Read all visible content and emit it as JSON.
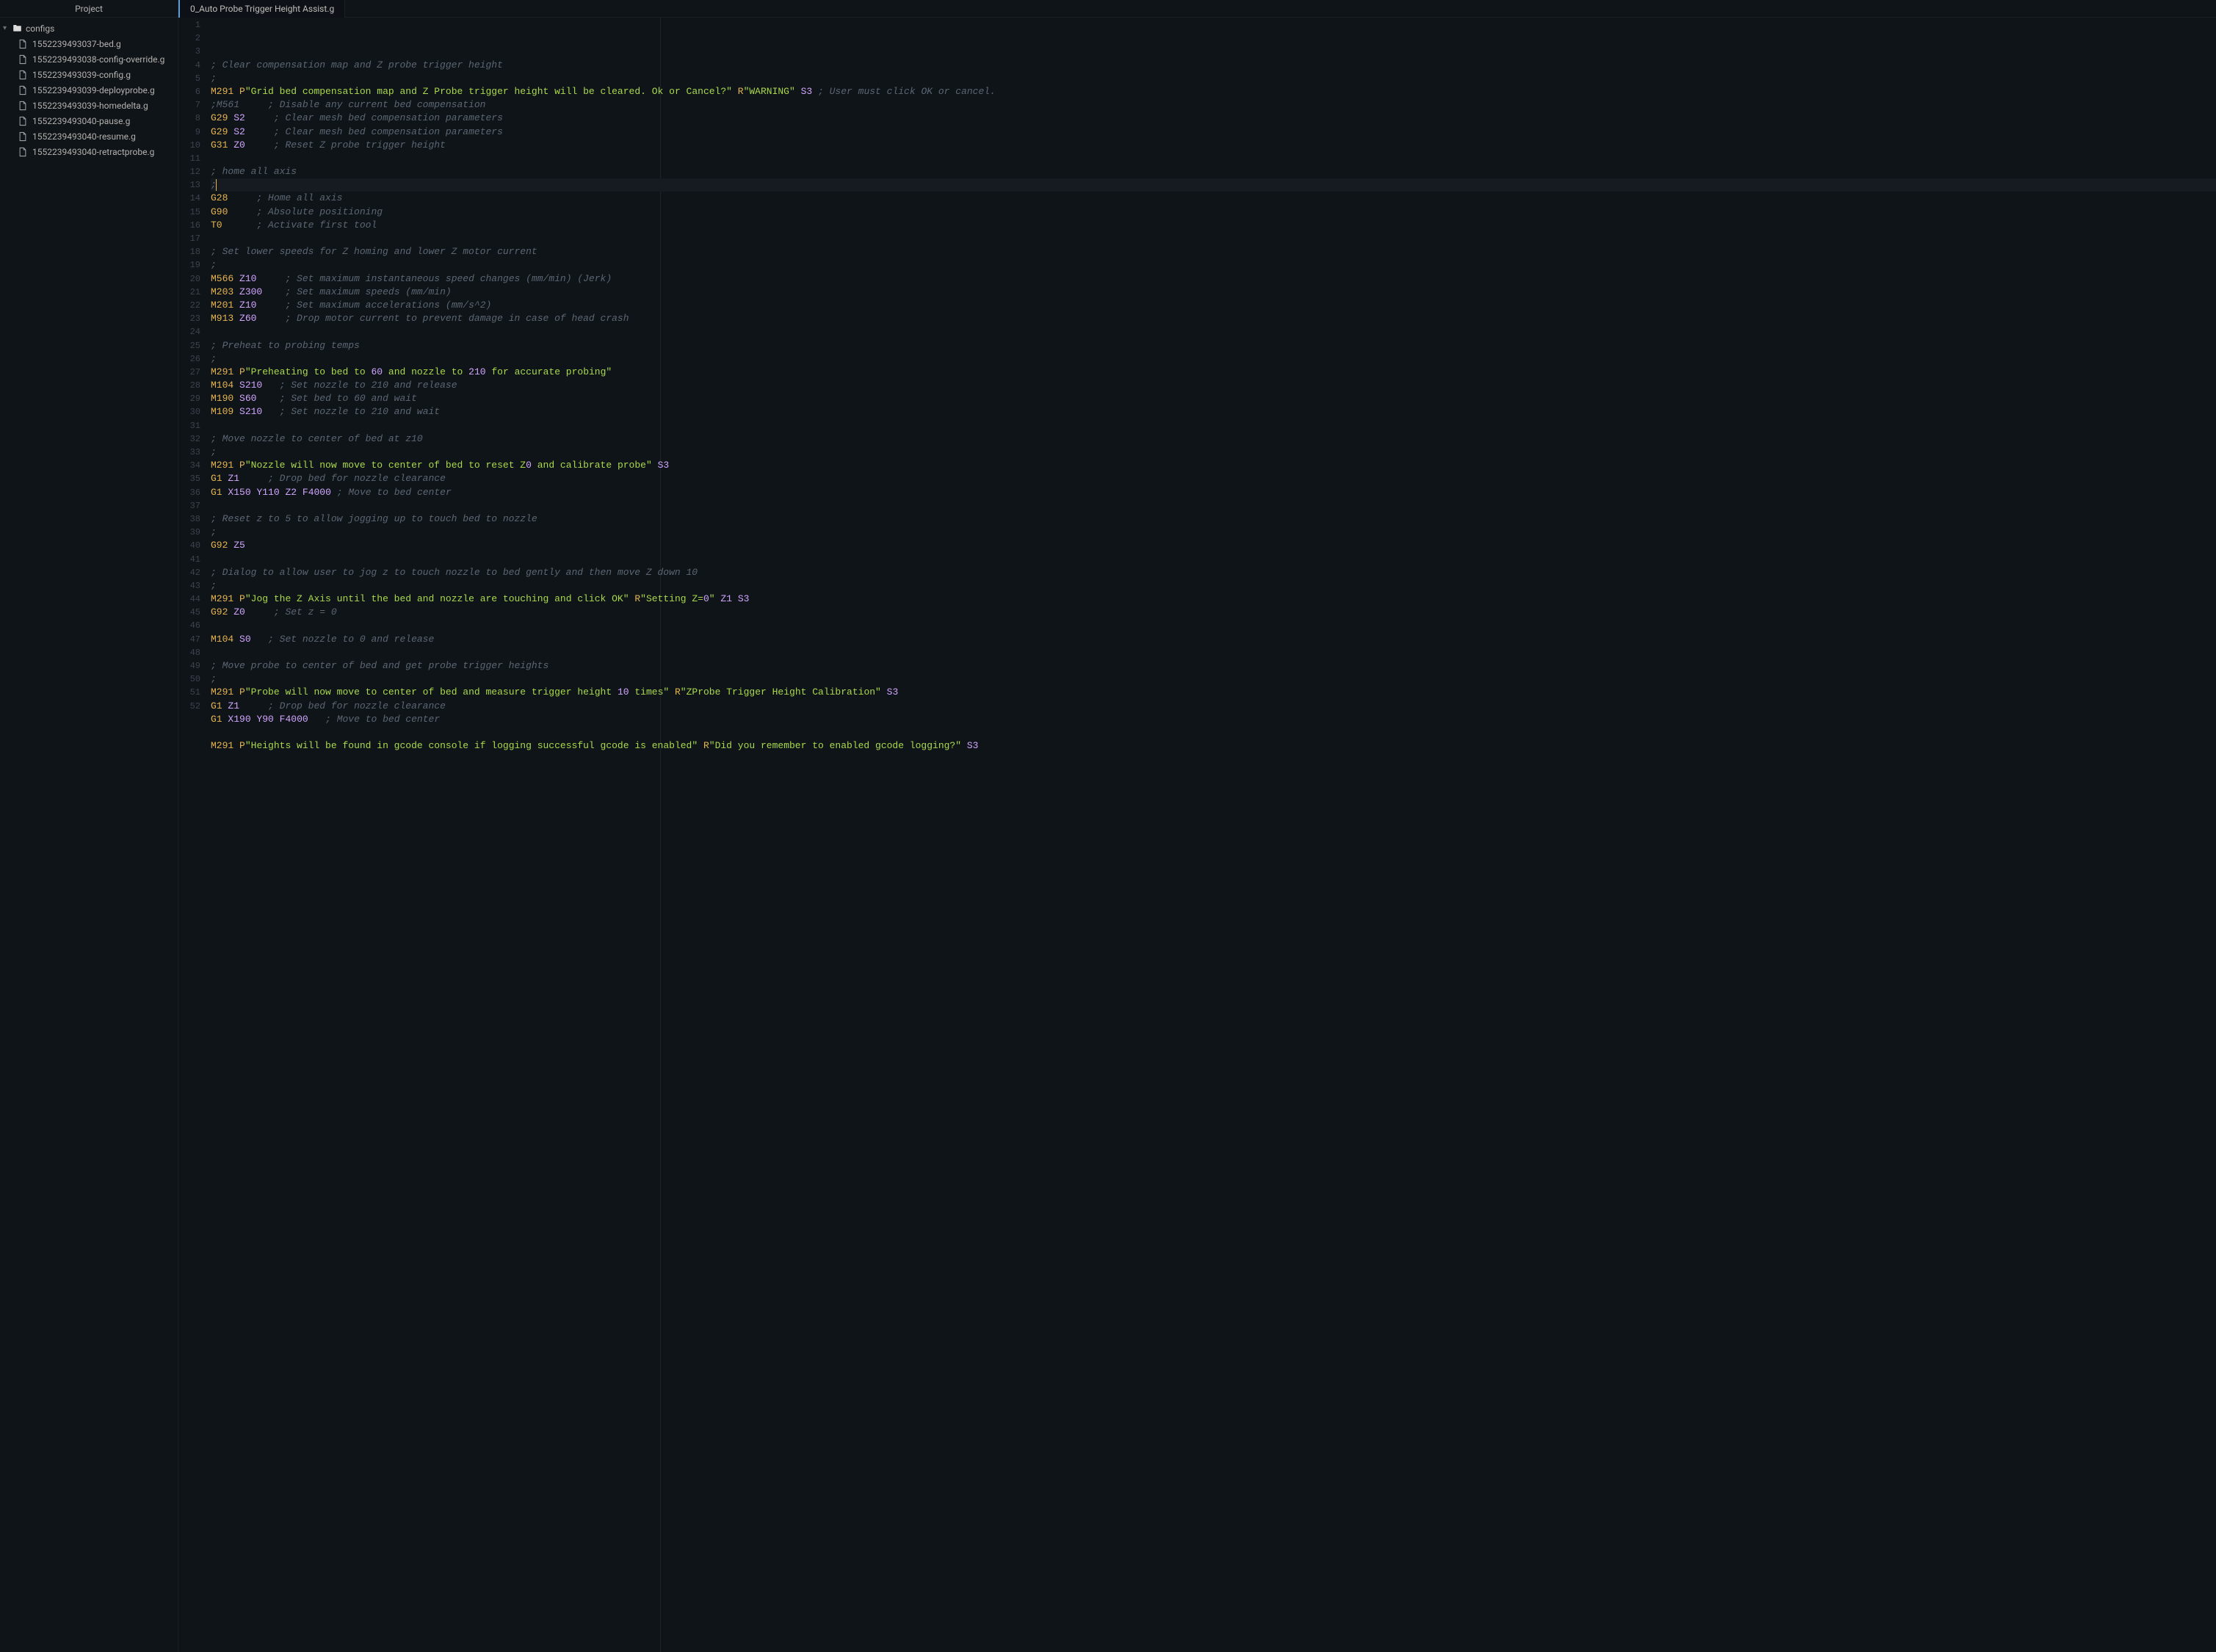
{
  "sidebar": {
    "title": "Project",
    "folder": "configs",
    "files": [
      "1552239493037-bed.g",
      "1552239493038-config-override.g",
      "1552239493039-config.g",
      "1552239493039-deployprobe.g",
      "1552239493039-homedelta.g",
      "1552239493040-pause.g",
      "1552239493040-resume.g",
      "1552239493040-retractprobe.g"
    ]
  },
  "tab": {
    "title": "0_Auto Probe Trigger Height Assist.g"
  },
  "code_lines": [
    {
      "n": 1,
      "tokens": [
        {
          "t": "comment",
          "v": "; Clear compensation map and Z probe trigger height"
        }
      ]
    },
    {
      "n": 2,
      "tokens": [
        {
          "t": "comment",
          "v": ";"
        }
      ]
    },
    {
      "n": 3,
      "tokens": [
        {
          "t": "mcode",
          "v": "M291"
        },
        {
          "t": "plain",
          "v": " "
        },
        {
          "t": "letter",
          "v": "P"
        },
        {
          "t": "str",
          "v": "\"Grid bed compensation map and Z Probe trigger height will be cleared. Ok or Cancel?\""
        },
        {
          "t": "plain",
          "v": " "
        },
        {
          "t": "letter",
          "v": "R"
        },
        {
          "t": "str",
          "v": "\"WARNING\""
        },
        {
          "t": "plain",
          "v": " "
        },
        {
          "t": "param",
          "v": "S3"
        },
        {
          "t": "plain",
          "v": " "
        },
        {
          "t": "comment",
          "v": "; User must click OK or cancel."
        }
      ]
    },
    {
      "n": 4,
      "tokens": [
        {
          "t": "comment",
          "v": ";M561     ; Disable any current bed compensation"
        }
      ]
    },
    {
      "n": 5,
      "tokens": [
        {
          "t": "gcode",
          "v": "G29"
        },
        {
          "t": "plain",
          "v": " "
        },
        {
          "t": "param",
          "v": "S2"
        },
        {
          "t": "plain",
          "v": "     "
        },
        {
          "t": "comment",
          "v": "; Clear mesh bed compensation parameters"
        }
      ]
    },
    {
      "n": 6,
      "tokens": [
        {
          "t": "gcode",
          "v": "G29"
        },
        {
          "t": "plain",
          "v": " "
        },
        {
          "t": "param",
          "v": "S2"
        },
        {
          "t": "plain",
          "v": "     "
        },
        {
          "t": "comment",
          "v": "; Clear mesh bed compensation parameters"
        }
      ]
    },
    {
      "n": 7,
      "tokens": [
        {
          "t": "gcode",
          "v": "G31"
        },
        {
          "t": "plain",
          "v": " "
        },
        {
          "t": "param",
          "v": "Z0"
        },
        {
          "t": "plain",
          "v": "     "
        },
        {
          "t": "comment",
          "v": "; Reset Z probe trigger height"
        }
      ]
    },
    {
      "n": 8,
      "tokens": []
    },
    {
      "n": 9,
      "tokens": [
        {
          "t": "comment",
          "v": "; home all axis"
        }
      ]
    },
    {
      "n": 10,
      "current": true,
      "cursor_after": true,
      "tokens": [
        {
          "t": "comment",
          "v": ";"
        }
      ]
    },
    {
      "n": 11,
      "tokens": [
        {
          "t": "gcode",
          "v": "G28"
        },
        {
          "t": "plain",
          "v": "     "
        },
        {
          "t": "comment",
          "v": "; Home all axis"
        }
      ]
    },
    {
      "n": 12,
      "tokens": [
        {
          "t": "gcode",
          "v": "G90"
        },
        {
          "t": "plain",
          "v": "     "
        },
        {
          "t": "comment",
          "v": "; Absolute positioning"
        }
      ]
    },
    {
      "n": 13,
      "tokens": [
        {
          "t": "gcode",
          "v": "T0"
        },
        {
          "t": "plain",
          "v": "      "
        },
        {
          "t": "comment",
          "v": "; Activate first tool"
        }
      ]
    },
    {
      "n": 14,
      "tokens": []
    },
    {
      "n": 15,
      "tokens": [
        {
          "t": "comment",
          "v": "; Set lower speeds for Z homing and lower Z motor current"
        }
      ]
    },
    {
      "n": 16,
      "tokens": [
        {
          "t": "comment",
          "v": ";"
        }
      ]
    },
    {
      "n": 17,
      "tokens": [
        {
          "t": "mcode",
          "v": "M566"
        },
        {
          "t": "plain",
          "v": " "
        },
        {
          "t": "param",
          "v": "Z10"
        },
        {
          "t": "plain",
          "v": "     "
        },
        {
          "t": "comment",
          "v": "; Set maximum instantaneous speed changes (mm/min) (Jerk)"
        }
      ]
    },
    {
      "n": 18,
      "tokens": [
        {
          "t": "mcode",
          "v": "M203"
        },
        {
          "t": "plain",
          "v": " "
        },
        {
          "t": "param",
          "v": "Z300"
        },
        {
          "t": "plain",
          "v": "    "
        },
        {
          "t": "comment",
          "v": "; Set maximum speeds (mm/min)"
        }
      ]
    },
    {
      "n": 19,
      "tokens": [
        {
          "t": "mcode",
          "v": "M201"
        },
        {
          "t": "plain",
          "v": " "
        },
        {
          "t": "param",
          "v": "Z10"
        },
        {
          "t": "plain",
          "v": "     "
        },
        {
          "t": "comment",
          "v": "; Set maximum accelerations (mm/s^2)"
        }
      ]
    },
    {
      "n": 20,
      "tokens": [
        {
          "t": "mcode",
          "v": "M913"
        },
        {
          "t": "plain",
          "v": " "
        },
        {
          "t": "param",
          "v": "Z60"
        },
        {
          "t": "plain",
          "v": "     "
        },
        {
          "t": "comment",
          "v": "; Drop motor current to prevent damage in case of head crash"
        }
      ]
    },
    {
      "n": 21,
      "tokens": []
    },
    {
      "n": 22,
      "tokens": [
        {
          "t": "comment",
          "v": "; Preheat to probing temps"
        }
      ]
    },
    {
      "n": 23,
      "tokens": [
        {
          "t": "comment",
          "v": ";"
        }
      ]
    },
    {
      "n": 24,
      "tokens": [
        {
          "t": "mcode",
          "v": "M291"
        },
        {
          "t": "plain",
          "v": " "
        },
        {
          "t": "letter",
          "v": "P"
        },
        {
          "t": "str",
          "v": "\"Preheating to bed to 60 and nozzle to 210 for accurate probing\""
        }
      ]
    },
    {
      "n": 25,
      "tokens": [
        {
          "t": "mcode",
          "v": "M104"
        },
        {
          "t": "plain",
          "v": " "
        },
        {
          "t": "param",
          "v": "S210"
        },
        {
          "t": "plain",
          "v": "   "
        },
        {
          "t": "comment",
          "v": "; Set nozzle to 210 and release"
        }
      ]
    },
    {
      "n": 26,
      "tokens": [
        {
          "t": "mcode",
          "v": "M190"
        },
        {
          "t": "plain",
          "v": " "
        },
        {
          "t": "param",
          "v": "S60"
        },
        {
          "t": "plain",
          "v": "    "
        },
        {
          "t": "comment",
          "v": "; Set bed to 60 and wait"
        }
      ]
    },
    {
      "n": 27,
      "tokens": [
        {
          "t": "mcode",
          "v": "M109"
        },
        {
          "t": "plain",
          "v": " "
        },
        {
          "t": "param",
          "v": "S210"
        },
        {
          "t": "plain",
          "v": "   "
        },
        {
          "t": "comment",
          "v": "; Set nozzle to 210 and wait"
        }
      ]
    },
    {
      "n": 28,
      "tokens": []
    },
    {
      "n": 29,
      "tokens": [
        {
          "t": "comment",
          "v": "; Move nozzle to center of bed at z10"
        }
      ]
    },
    {
      "n": 30,
      "tokens": [
        {
          "t": "comment",
          "v": ";"
        }
      ]
    },
    {
      "n": 31,
      "tokens": [
        {
          "t": "mcode",
          "v": "M291"
        },
        {
          "t": "plain",
          "v": " "
        },
        {
          "t": "letter",
          "v": "P"
        },
        {
          "t": "str",
          "v": "\"Nozzle will now move to center of bed to reset Z0 and calibrate probe\""
        },
        {
          "t": "plain",
          "v": " "
        },
        {
          "t": "param",
          "v": "S3"
        }
      ]
    },
    {
      "n": 32,
      "tokens": [
        {
          "t": "gcode",
          "v": "G1"
        },
        {
          "t": "plain",
          "v": " "
        },
        {
          "t": "param",
          "v": "Z1"
        },
        {
          "t": "plain",
          "v": "     "
        },
        {
          "t": "comment",
          "v": "; Drop bed for nozzle clearance"
        }
      ]
    },
    {
      "n": 33,
      "tokens": [
        {
          "t": "gcode",
          "v": "G1"
        },
        {
          "t": "plain",
          "v": " "
        },
        {
          "t": "param",
          "v": "X150"
        },
        {
          "t": "plain",
          "v": " "
        },
        {
          "t": "param",
          "v": "Y110"
        },
        {
          "t": "plain",
          "v": " "
        },
        {
          "t": "param",
          "v": "Z2"
        },
        {
          "t": "plain",
          "v": " "
        },
        {
          "t": "param",
          "v": "F4000"
        },
        {
          "t": "plain",
          "v": " "
        },
        {
          "t": "comment",
          "v": "; Move to bed center"
        }
      ]
    },
    {
      "n": 34,
      "tokens": []
    },
    {
      "n": 35,
      "tokens": [
        {
          "t": "comment",
          "v": "; Reset z to 5 to allow jogging up to touch bed to nozzle"
        }
      ]
    },
    {
      "n": 36,
      "tokens": [
        {
          "t": "comment",
          "v": ";"
        }
      ]
    },
    {
      "n": 37,
      "tokens": [
        {
          "t": "gcode",
          "v": "G92"
        },
        {
          "t": "plain",
          "v": " "
        },
        {
          "t": "param",
          "v": "Z5"
        }
      ]
    },
    {
      "n": 38,
      "tokens": []
    },
    {
      "n": 39,
      "tokens": [
        {
          "t": "comment",
          "v": "; Dialog to allow user to jog z to touch nozzle to bed gently and then move Z down 10"
        }
      ]
    },
    {
      "n": 40,
      "tokens": [
        {
          "t": "comment",
          "v": ";"
        }
      ]
    },
    {
      "n": 41,
      "tokens": [
        {
          "t": "mcode",
          "v": "M291"
        },
        {
          "t": "plain",
          "v": " "
        },
        {
          "t": "letter",
          "v": "P"
        },
        {
          "t": "str",
          "v": "\"Jog the Z Axis until the bed and nozzle are touching and click OK\""
        },
        {
          "t": "plain",
          "v": " "
        },
        {
          "t": "letter",
          "v": "R"
        },
        {
          "t": "str",
          "v": "\"Setting Z=0\""
        },
        {
          "t": "plain",
          "v": " "
        },
        {
          "t": "param",
          "v": "Z1"
        },
        {
          "t": "plain",
          "v": " "
        },
        {
          "t": "param",
          "v": "S3"
        }
      ]
    },
    {
      "n": 42,
      "tokens": [
        {
          "t": "gcode",
          "v": "G92"
        },
        {
          "t": "plain",
          "v": " "
        },
        {
          "t": "param",
          "v": "Z0"
        },
        {
          "t": "plain",
          "v": "     "
        },
        {
          "t": "comment",
          "v": "; Set z = 0"
        }
      ]
    },
    {
      "n": 43,
      "tokens": []
    },
    {
      "n": 44,
      "tokens": [
        {
          "t": "mcode",
          "v": "M104"
        },
        {
          "t": "plain",
          "v": " "
        },
        {
          "t": "param",
          "v": "S0"
        },
        {
          "t": "plain",
          "v": "   "
        },
        {
          "t": "comment",
          "v": "; Set nozzle to 0 and release"
        }
      ]
    },
    {
      "n": 45,
      "tokens": []
    },
    {
      "n": 46,
      "tokens": [
        {
          "t": "comment",
          "v": "; Move probe to center of bed and get probe trigger heights"
        }
      ]
    },
    {
      "n": 47,
      "tokens": [
        {
          "t": "comment",
          "v": ";"
        }
      ]
    },
    {
      "n": 48,
      "tokens": [
        {
          "t": "mcode",
          "v": "M291"
        },
        {
          "t": "plain",
          "v": " "
        },
        {
          "t": "letter",
          "v": "P"
        },
        {
          "t": "str",
          "v": "\"Probe will now move to center of bed and measure trigger height 10 times\""
        },
        {
          "t": "plain",
          "v": " "
        },
        {
          "t": "letter",
          "v": "R"
        },
        {
          "t": "str",
          "v": "\"ZProbe Trigger Height Calibration\""
        },
        {
          "t": "plain",
          "v": " "
        },
        {
          "t": "param",
          "v": "S3"
        }
      ]
    },
    {
      "n": 49,
      "tokens": [
        {
          "t": "gcode",
          "v": "G1"
        },
        {
          "t": "plain",
          "v": " "
        },
        {
          "t": "param",
          "v": "Z1"
        },
        {
          "t": "plain",
          "v": "     "
        },
        {
          "t": "comment",
          "v": "; Drop bed for nozzle clearance"
        }
      ]
    },
    {
      "n": 50,
      "tokens": [
        {
          "t": "gcode",
          "v": "G1"
        },
        {
          "t": "plain",
          "v": " "
        },
        {
          "t": "param",
          "v": "X190"
        },
        {
          "t": "plain",
          "v": " "
        },
        {
          "t": "param",
          "v": "Y90"
        },
        {
          "t": "plain",
          "v": " "
        },
        {
          "t": "param",
          "v": "F4000"
        },
        {
          "t": "plain",
          "v": "   "
        },
        {
          "t": "comment",
          "v": "; Move to bed center"
        }
      ]
    },
    {
      "n": 51,
      "tokens": []
    },
    {
      "n": 52,
      "tokens": [
        {
          "t": "mcode",
          "v": "M291"
        },
        {
          "t": "plain",
          "v": " "
        },
        {
          "t": "letter",
          "v": "P"
        },
        {
          "t": "str",
          "v": "\"Heights will be found in gcode console if logging successful gcode is enabled\""
        },
        {
          "t": "plain",
          "v": " "
        },
        {
          "t": "letter",
          "v": "R"
        },
        {
          "t": "str",
          "v": "\"Did you remember to enabled gcode logging?\""
        },
        {
          "t": "plain",
          "v": " "
        },
        {
          "t": "param",
          "v": "S3"
        }
      ]
    }
  ]
}
